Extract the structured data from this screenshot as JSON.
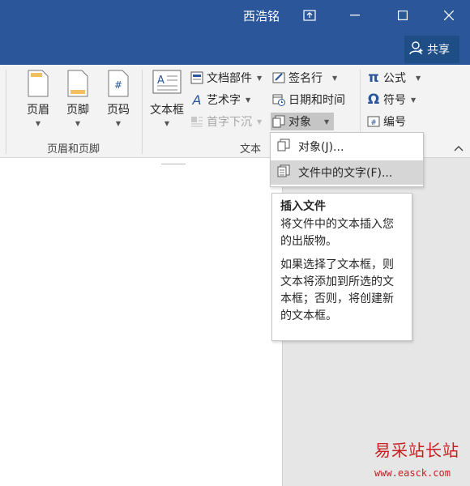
{
  "titlebar": {
    "user": "西浩铭"
  },
  "share": {
    "label": "共享"
  },
  "ribbon": {
    "header_footer": {
      "header": "页眉",
      "footer": "页脚",
      "page_number": "页码",
      "group": "页眉和页脚"
    },
    "text": {
      "textbox": "文本框",
      "quick_parts": "文档部件",
      "wordart": "艺术字",
      "drop_cap": "首字下沉",
      "signature_line": "签名行",
      "date_time": "日期和时间",
      "object": "对象",
      "group": "文本"
    },
    "symbols": {
      "equation": "公式",
      "symbol": "符号",
      "numbering": "编号"
    }
  },
  "object_menu": {
    "items": [
      {
        "label": "对象(J)..."
      },
      {
        "label": "文件中的文字(F)..."
      }
    ]
  },
  "tooltip": {
    "title": "插入文件",
    "desc1": "将文件中的文本插入您的出版物。",
    "desc2": "如果选择了文本框，则文本将添加到所选的文本框；否则，将创建新的文本框。"
  },
  "watermark": {
    "cn": "易采站长站",
    "url": "www.easck.com"
  },
  "colors": {
    "titlebar": "#2b579a",
    "share": "#1f4e87",
    "ribbon": "#f3f3f3"
  }
}
